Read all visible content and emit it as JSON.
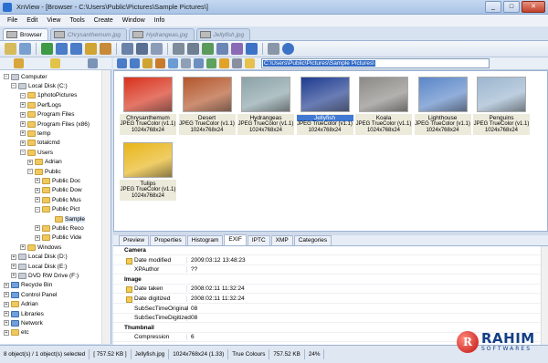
{
  "window": {
    "title": "XnView - [Browser - C:\\Users\\Public\\Pictures\\Sample Pictures\\]"
  },
  "menu": [
    "File",
    "Edit",
    "View",
    "Tools",
    "Create",
    "Window",
    "Info"
  ],
  "tabs": [
    {
      "label": "Browser",
      "active": true
    },
    {
      "label": "Chrysanthemum.jpg",
      "active": false
    },
    {
      "label": "Hydrangeas.jpg",
      "active": false
    },
    {
      "label": "Jellyfish.jpg",
      "active": false
    }
  ],
  "path": "C:\\Users\\Public\\Pictures\\Sample Pictures\\",
  "tree": [
    {
      "label": "Computer",
      "icon": "computer-icon"
    },
    {
      "label": "Local Disk (C:)",
      "icon": "drive-icon"
    },
    {
      "label": "1photoPictures",
      "icon": "folder-icon"
    },
    {
      "label": "PerfLogs",
      "icon": "folder-icon"
    },
    {
      "label": "Program Files",
      "icon": "folder-icon"
    },
    {
      "label": "Program Files (x86)",
      "icon": "folder-icon"
    },
    {
      "label": "temp",
      "icon": "folder-icon"
    },
    {
      "label": "totalcmd",
      "icon": "folder-icon"
    },
    {
      "label": "Users",
      "icon": "folder-icon"
    },
    {
      "label": "Adrian",
      "icon": "folder-icon"
    },
    {
      "label": "Public",
      "icon": "folder-icon"
    },
    {
      "label": "Public Doc",
      "icon": "folder-icon"
    },
    {
      "label": "Public Dow",
      "icon": "folder-icon"
    },
    {
      "label": "Public Mus",
      "icon": "folder-icon"
    },
    {
      "label": "Public Pict",
      "icon": "folder-icon"
    },
    {
      "label": "Sample",
      "icon": "folder-icon"
    },
    {
      "label": "Public Reco",
      "icon": "folder-icon"
    },
    {
      "label": "Public Vide",
      "icon": "folder-icon"
    },
    {
      "label": "Windows",
      "icon": "folder-icon"
    },
    {
      "label": "Local Disk (D:)",
      "icon": "drive-icon"
    },
    {
      "label": "Local Disk (E:)",
      "icon": "drive-icon"
    },
    {
      "label": "DVD RW Drive (F:)",
      "icon": "dvd-icon"
    },
    {
      "label": "Recycle Bin",
      "icon": "recycle-bin-icon"
    },
    {
      "label": "Control Panel",
      "icon": "control-panel-icon"
    },
    {
      "label": "Adrian",
      "icon": "user-folder-icon"
    },
    {
      "label": "Libraries",
      "icon": "libraries-icon"
    },
    {
      "label": "Network",
      "icon": "network-icon"
    },
    {
      "label": "etc",
      "icon": "folder-icon"
    }
  ],
  "thumbnails": [
    {
      "name": "Chrysanthemum",
      "info": "JPEG TrueColor (v1.1)",
      "dims": "1024x768x24",
      "color": "#d8321c"
    },
    {
      "name": "Desert",
      "info": "JPEG TrueColor (v1.1)",
      "dims": "1024x768x24",
      "color": "#b4562b"
    },
    {
      "name": "Hydrangeas",
      "info": "JPEG TrueColor (v1.1)",
      "dims": "1024x768x24",
      "color": "#8aa3a8"
    },
    {
      "name": "Jellyfish",
      "info": "JPEG TrueColor (v1.1)",
      "dims": "1024x768x24",
      "color": "#1e3b8f",
      "selected": true
    },
    {
      "name": "Koala",
      "info": "JPEG TrueColor (v1.1)",
      "dims": "1024x768x24",
      "color": "#8c8a86"
    },
    {
      "name": "Lighthouse",
      "info": "JPEG TrueColor (v1.1)",
      "dims": "1024x768x24",
      "color": "#5a86c8"
    },
    {
      "name": "Penguins",
      "info": "JPEG TrueColor (v1.1)",
      "dims": "1024x768x24",
      "color": "#9cb6cf"
    },
    {
      "name": "Tulips",
      "info": "JPEG TrueColor (v1.1)",
      "dims": "1024x768x24",
      "color": "#e8b51a"
    }
  ],
  "info_tabs": [
    {
      "label": "Preview",
      "active": false
    },
    {
      "label": "Properties",
      "active": false
    },
    {
      "label": "Histogram",
      "active": false
    },
    {
      "label": "EXIF",
      "active": true
    },
    {
      "label": "IPTC",
      "active": false
    },
    {
      "label": "XMP",
      "active": false
    },
    {
      "label": "Categories",
      "active": false
    }
  ],
  "exif": [
    {
      "group": "Camera"
    },
    {
      "key": "Date modified",
      "value": "2009:03:12 13:48:23",
      "editable": true
    },
    {
      "key": "XPAuthor",
      "value": "??"
    },
    {
      "group": "Image"
    },
    {
      "key": "Date taken",
      "value": "2008:02:11 11:32:24",
      "editable": true
    },
    {
      "key": "Date digitized",
      "value": "2008:02:11 11:32:24",
      "editable": true
    },
    {
      "key": "SubSecTimeOriginal",
      "value": "08"
    },
    {
      "key": "SubSecTimeDigitized",
      "value": "08"
    },
    {
      "group": "Thumbnail"
    },
    {
      "key": "Compression",
      "value": "6"
    }
  ],
  "status": [
    "8 object(s) / 1 object(s) selected",
    "[ 757.52 KB ]",
    "Jellyfish.jpg",
    "1024x768x24 (1.33)",
    "True Colours",
    "757.52 KB",
    "24%"
  ],
  "watermark": {
    "mark": "R",
    "name": "RAHIM",
    "sub": "SOFTWARES"
  }
}
